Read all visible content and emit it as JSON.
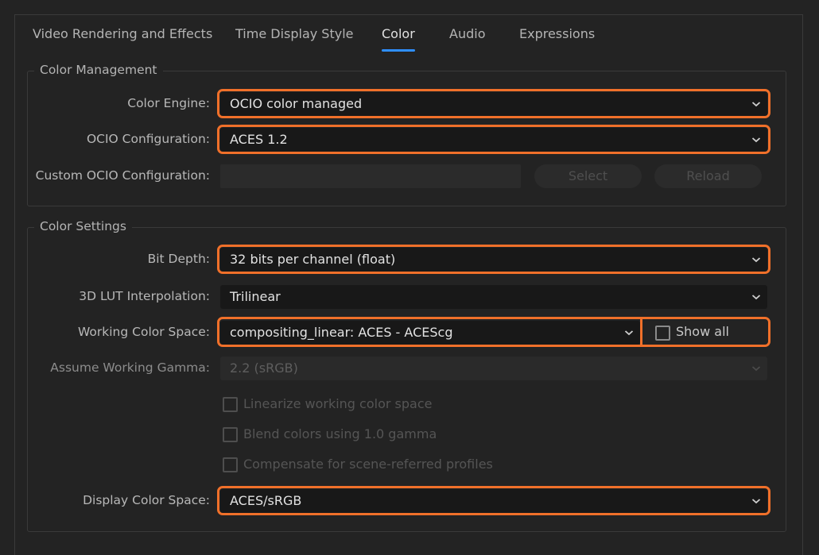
{
  "tabs": [
    {
      "label": "Video Rendering and Effects"
    },
    {
      "label": "Time Display Style"
    },
    {
      "label": "Color"
    },
    {
      "label": "Audio"
    },
    {
      "label": "Expressions"
    }
  ],
  "active_tab": "Color",
  "color_management": {
    "title": "Color Management",
    "color_engine": {
      "label": "Color Engine:",
      "value": "OCIO color managed"
    },
    "ocio_configuration": {
      "label": "OCIO Configuration:",
      "value": "ACES 1.2"
    },
    "custom_ocio": {
      "label": "Custom OCIO Configuration:",
      "value": "",
      "select_label": "Select",
      "reload_label": "Reload"
    }
  },
  "color_settings": {
    "title": "Color Settings",
    "bit_depth": {
      "label": "Bit Depth:",
      "value": "32 bits per channel (float)"
    },
    "lut_interpolation": {
      "label": "3D LUT Interpolation:",
      "value": "Trilinear"
    },
    "working_color_space": {
      "label": "Working Color Space:",
      "value": "compositing_linear: ACES - ACEScg",
      "show_all_label": "Show all",
      "show_all_checked": false
    },
    "assume_gamma": {
      "label": "Assume Working Gamma:",
      "value": "2.2 (sRGB)"
    },
    "checkboxes": [
      {
        "label": "Linearize working color space",
        "checked": false
      },
      {
        "label": "Blend colors using 1.0 gamma",
        "checked": false
      },
      {
        "label": "Compensate for scene-referred profiles",
        "checked": false
      }
    ],
    "display_color_space": {
      "label": "Display Color Space:",
      "value": "ACES/sRGB"
    }
  },
  "colors": {
    "highlight": "#f0702a",
    "tab_underline": "#2f8fff",
    "background": "#232323"
  }
}
